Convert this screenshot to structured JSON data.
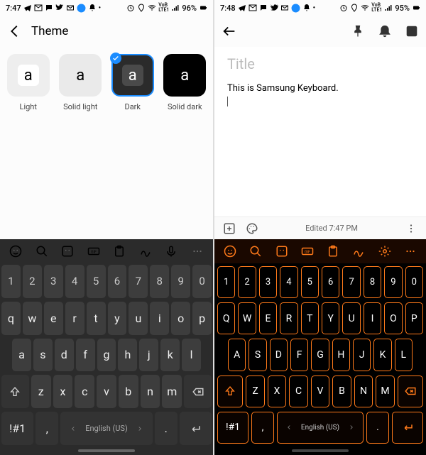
{
  "left": {
    "status": {
      "time": "7:47",
      "battery": "96%"
    },
    "header": {
      "title": "Theme"
    },
    "themes": [
      {
        "label": "Light",
        "glyph": "a",
        "tile_bg": "#eeeeee",
        "inner_bg": "#ffffff",
        "inner_fg": "#000000",
        "selected": false
      },
      {
        "label": "Solid light",
        "glyph": "a",
        "tile_bg": "#eaeaea",
        "inner_bg": "#eaeaea",
        "inner_fg": "#000000",
        "selected": false
      },
      {
        "label": "Dark",
        "glyph": "a",
        "tile_bg": "#2b2b2b",
        "inner_bg": "#4a4a4a",
        "inner_fg": "#ffffff",
        "selected": true
      },
      {
        "label": "Solid dark",
        "glyph": "a",
        "tile_bg": "#000000",
        "inner_bg": "#000000",
        "inner_fg": "#ffffff",
        "selected": false
      }
    ],
    "keyboard": {
      "row_num": [
        "1",
        "2",
        "3",
        "4",
        "5",
        "6",
        "7",
        "8",
        "9",
        "0"
      ],
      "row1": [
        "q",
        "w",
        "e",
        "r",
        "t",
        "y",
        "u",
        "i",
        "o",
        "p"
      ],
      "row2": [
        "a",
        "s",
        "d",
        "f",
        "g",
        "h",
        "j",
        "k",
        "l"
      ],
      "row3": [
        "z",
        "x",
        "c",
        "v",
        "b",
        "n",
        "m"
      ],
      "fn_key": "!#1",
      "comma": ",",
      "period": ".",
      "space_label": "English (US)"
    }
  },
  "right": {
    "status": {
      "time": "7:48",
      "battery": "95%"
    },
    "note": {
      "title_placeholder": "Title",
      "body": "This is Samsung Keyboard."
    },
    "editbar": {
      "edited": "Edited 7:47 PM"
    },
    "keyboard": {
      "row_num": [
        "1",
        "2",
        "3",
        "4",
        "5",
        "6",
        "7",
        "8",
        "9",
        "0"
      ],
      "row1": [
        "Q",
        "W",
        "E",
        "R",
        "T",
        "Y",
        "U",
        "I",
        "O",
        "P"
      ],
      "row2": [
        "A",
        "S",
        "D",
        "F",
        "G",
        "H",
        "J",
        "K",
        "L"
      ],
      "row3": [
        "Z",
        "X",
        "C",
        "V",
        "B",
        "N",
        "M"
      ],
      "fn_key": "!#1",
      "comma": ",",
      "period": ".",
      "space_label": "English (US)"
    }
  }
}
